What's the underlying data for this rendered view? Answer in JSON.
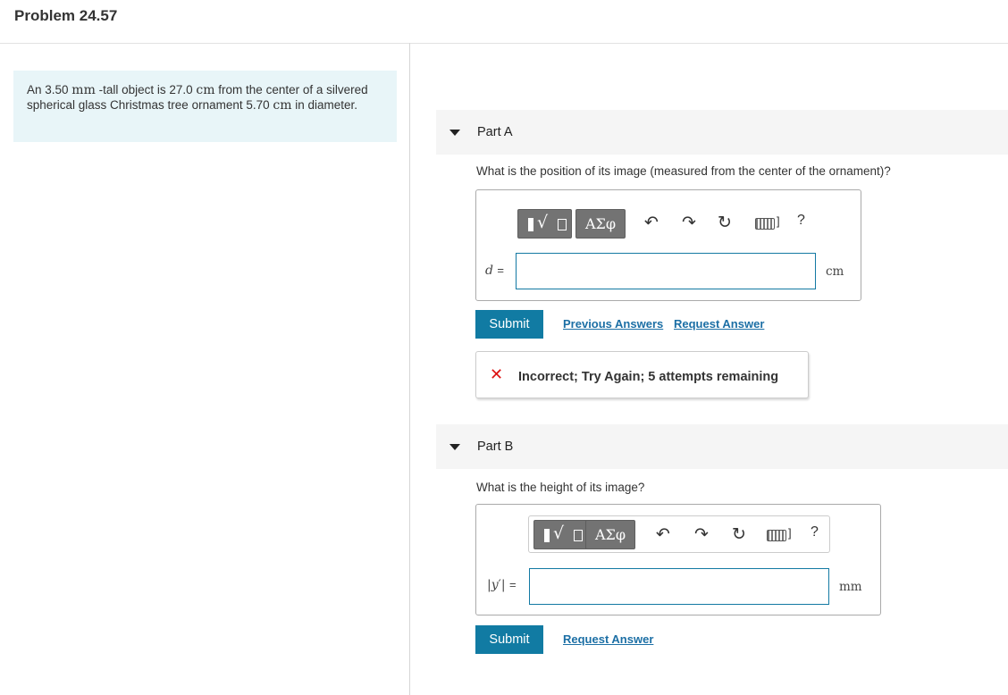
{
  "header": {
    "title": "Problem 24.57"
  },
  "problem": {
    "p1": "An 3.50 ",
    "u1": "mm",
    "p2": " -tall object is 27.0 ",
    "u2": "cm",
    "p3": " from the center of a silvered spherical glass Christmas tree ornament 5.70 ",
    "u3": "cm",
    "p4": " in diameter."
  },
  "parts": [
    {
      "label": "Part A",
      "question": "What is the position of its image (measured from the center of the ornament)?",
      "variable": "d",
      "equals": "=",
      "input_value": "",
      "unit": "cm",
      "submit_label": "Submit",
      "previous_answers_label": "Previous Answers",
      "request_answer_label": "Request Answer",
      "feedback": {
        "status": "incorrect",
        "message": "Incorrect; Try Again; 5 attempts remaining",
        "color": "#dd1111"
      }
    },
    {
      "label": "Part B",
      "question": "What is the height of its image?",
      "variable_left": "|",
      "variable": "y",
      "variable_right": "′|",
      "equals": "=",
      "input_value": "",
      "unit": "mm",
      "submit_label": "Submit",
      "request_answer_label": "Request Answer"
    }
  ],
  "toolbar": {
    "greek_label": "ΑΣφ",
    "help_label": "?",
    "keyboard_bracket": "]",
    "icons": [
      "templates-icon",
      "greek-symbols-icon",
      "undo-icon",
      "redo-icon",
      "reset-icon",
      "keyboard-icon",
      "help-icon"
    ]
  },
  "colors": {
    "accent": "#117ba3",
    "problem_bg": "#e8f5f8",
    "error": "#dd1111",
    "link": "#1c6fa5"
  }
}
